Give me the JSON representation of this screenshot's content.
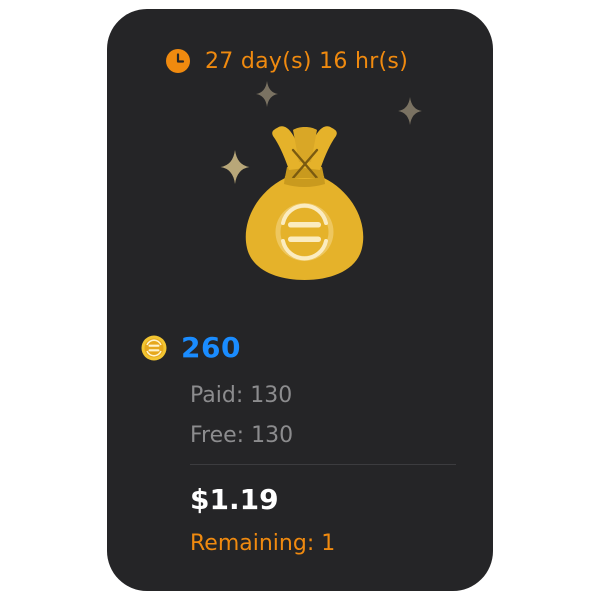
{
  "offer": {
    "timer_text": "27 day(s) 16 hr(s)",
    "coin_amount": "260",
    "paid_text": "Paid: 130",
    "free_text": "Free: 130",
    "price": "$1.19",
    "remaining_text": "Remaining: 1"
  },
  "icons": {
    "timer": "clock-icon",
    "illustration": "money-bag-icon",
    "coin": "coin-icon",
    "sparkles": "sparkle-icon"
  },
  "colors": {
    "card_background": "#252527",
    "accent_orange": "#f08a0f",
    "coin_blue": "#1a8cff",
    "muted_text": "#8c8c8e",
    "price_text": "#ffffff",
    "gold": "#e5b22a"
  }
}
